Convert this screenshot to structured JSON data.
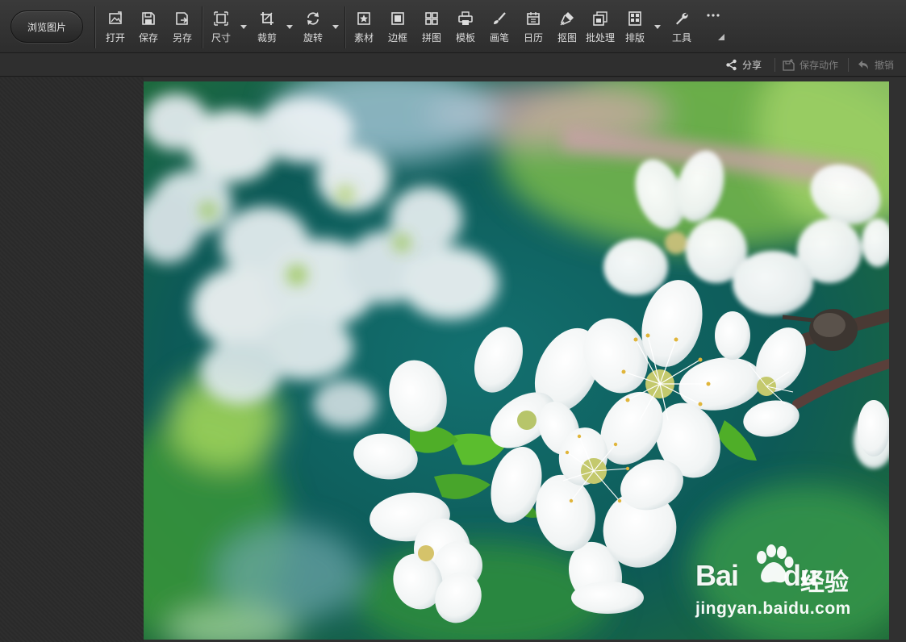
{
  "toolbar": {
    "browse_label": "浏览图片",
    "tools": [
      {
        "id": "open",
        "label": "打开",
        "icon": "open-image-icon"
      },
      {
        "id": "save",
        "label": "保存",
        "icon": "save-icon"
      },
      {
        "id": "save-as",
        "label": "另存",
        "icon": "save-as-icon"
      },
      {
        "id": "size",
        "label": "尺寸",
        "icon": "resize-icon"
      },
      {
        "id": "crop",
        "label": "裁剪",
        "icon": "crop-icon"
      },
      {
        "id": "rotate",
        "label": "旋转",
        "icon": "rotate-icon"
      },
      {
        "id": "material",
        "label": "素材",
        "icon": "material-star-icon"
      },
      {
        "id": "border",
        "label": "边框",
        "icon": "border-frame-icon"
      },
      {
        "id": "collage",
        "label": "拼图",
        "icon": "collage-grid-icon"
      },
      {
        "id": "template",
        "label": "模板",
        "icon": "template-printer-icon"
      },
      {
        "id": "brush",
        "label": "画笔",
        "icon": "brush-icon"
      },
      {
        "id": "calendar",
        "label": "日历",
        "icon": "calendar-icon"
      },
      {
        "id": "cutout",
        "label": "抠图",
        "icon": "pen-cutout-icon"
      },
      {
        "id": "batch",
        "label": "批处理",
        "icon": "batch-icon"
      },
      {
        "id": "layout",
        "label": "排版",
        "icon": "layout-icon"
      },
      {
        "id": "tools",
        "label": "工具",
        "icon": "wrench-icon"
      }
    ],
    "more_icon": "more-dots-icon"
  },
  "subbar": {
    "share_label": "分享",
    "save_action_label": "保存动作",
    "undo_label": "撤销"
  },
  "watermark": {
    "brand_text": "Bai",
    "brand_suffix": "du",
    "jingyan_text": "经验",
    "url_text": "jingyan.baidu.com"
  },
  "colors": {
    "toolbar_bg": "#333333",
    "text": "#dcdcdc",
    "disabled_text": "#808080",
    "canvas_bg": "#303030"
  }
}
